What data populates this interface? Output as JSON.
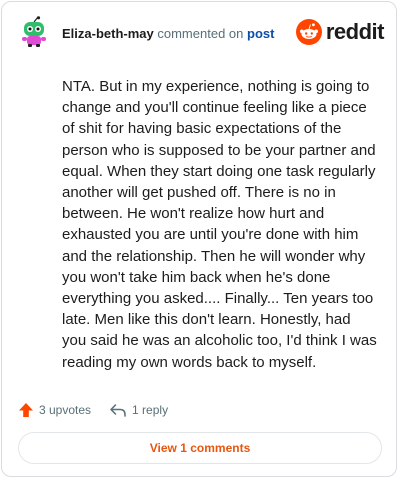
{
  "comment": {
    "username": "Eliza-beth-may",
    "action_text": "commented on",
    "post_link": "post",
    "body": "NTA. But in my experience, nothing is going to change and you'll continue feeling like a piece of shit for having basic expectations of the person who is supposed to be your partner and equal. When they start doing one task regularly another will get pushed off. There is no in between. He won't realize how hurt and exhausted you are until you're done with him and the relationship. Then he will wonder why you won't take him back when he's done everything you asked.... Finally... Ten years too late. Men like this don't learn. Honestly, had you said he was an alcoholic too, I'd think I was reading my own words back to myself.",
    "upvotes": "3 upvotes",
    "replies": "1 reply",
    "view_comments": "View 1 comments"
  },
  "brand": {
    "name": "reddit",
    "color": "#ff4500"
  },
  "icons": {
    "avatar": "snoo-avatar-icon",
    "logo": "reddit-snoo-icon",
    "upvote": "upvote-arrow-icon",
    "reply": "reply-arrow-icon"
  },
  "colors": {
    "upvote": "#ff4500",
    "link": "#0a4fa8",
    "view_button_text": "#e8560f"
  }
}
